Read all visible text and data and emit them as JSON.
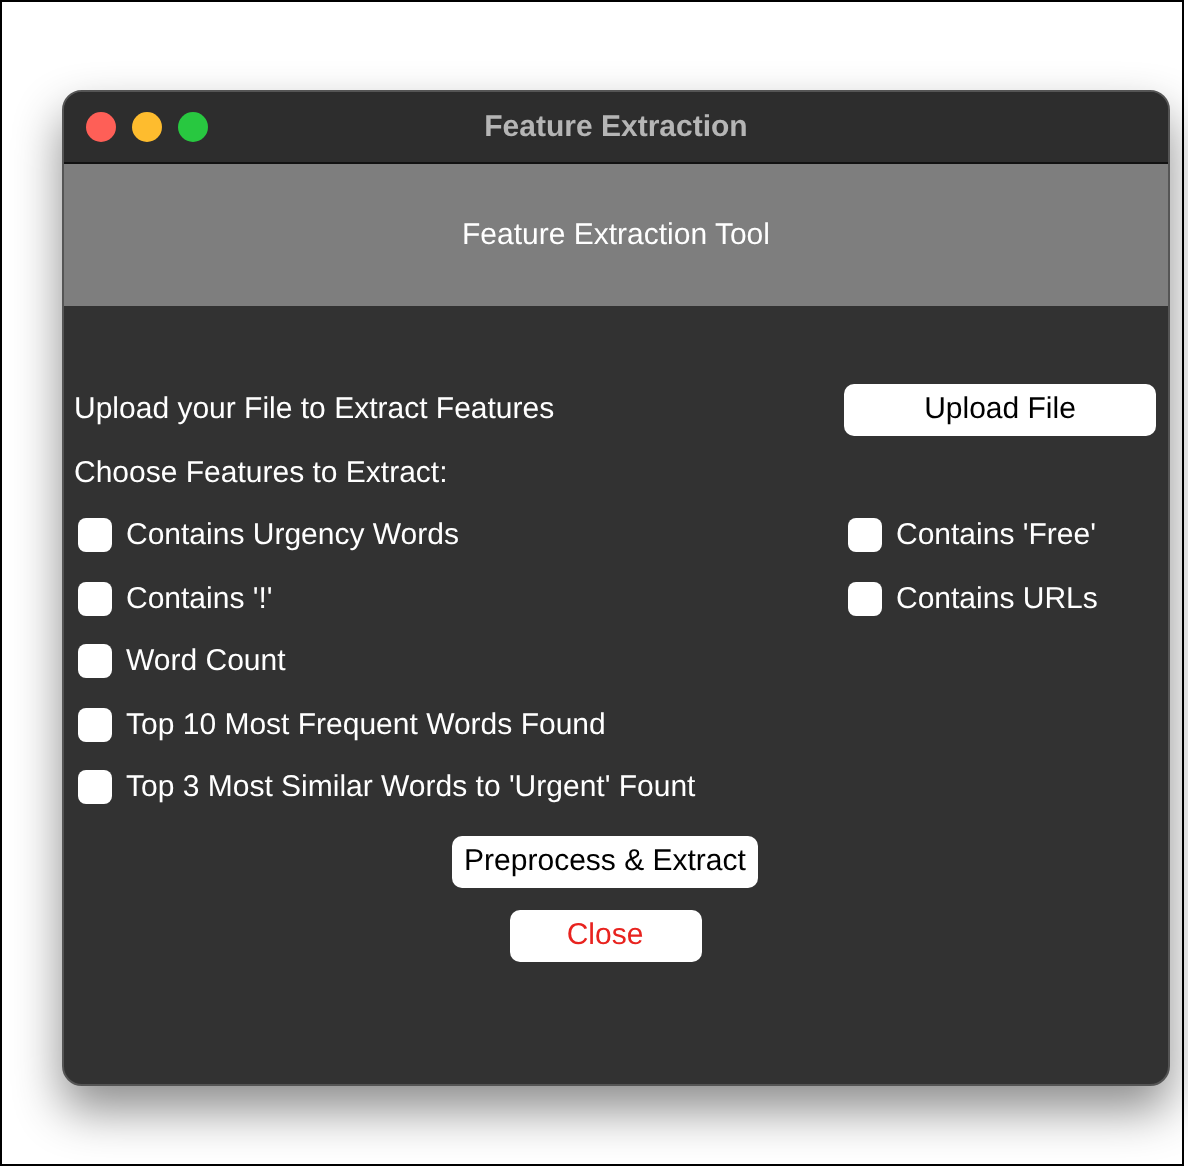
{
  "window": {
    "title": "Feature Extraction"
  },
  "header": {
    "title": "Feature Extraction Tool"
  },
  "upload": {
    "label": "Upload your File to Extract Features",
    "button": "Upload File"
  },
  "features_heading": "Choose Features to Extract:",
  "features_left": [
    {
      "label": "Contains Urgency Words",
      "checked": false
    },
    {
      "label": "Contains '!'",
      "checked": false
    },
    {
      "label": "Word Count",
      "checked": false
    },
    {
      "label": "Top 10 Most Frequent Words Found",
      "checked": false
    },
    {
      "label": "Top 3 Most Similar Words to 'Urgent' Fount",
      "checked": false
    }
  ],
  "features_right": [
    {
      "label": "Contains 'Free'",
      "checked": false
    },
    {
      "label": "Contains URLs",
      "checked": false
    }
  ],
  "actions": [
    {
      "label": "Preprocess & Extract",
      "kind": "primary"
    },
    {
      "label": "Close",
      "kind": "danger"
    }
  ]
}
